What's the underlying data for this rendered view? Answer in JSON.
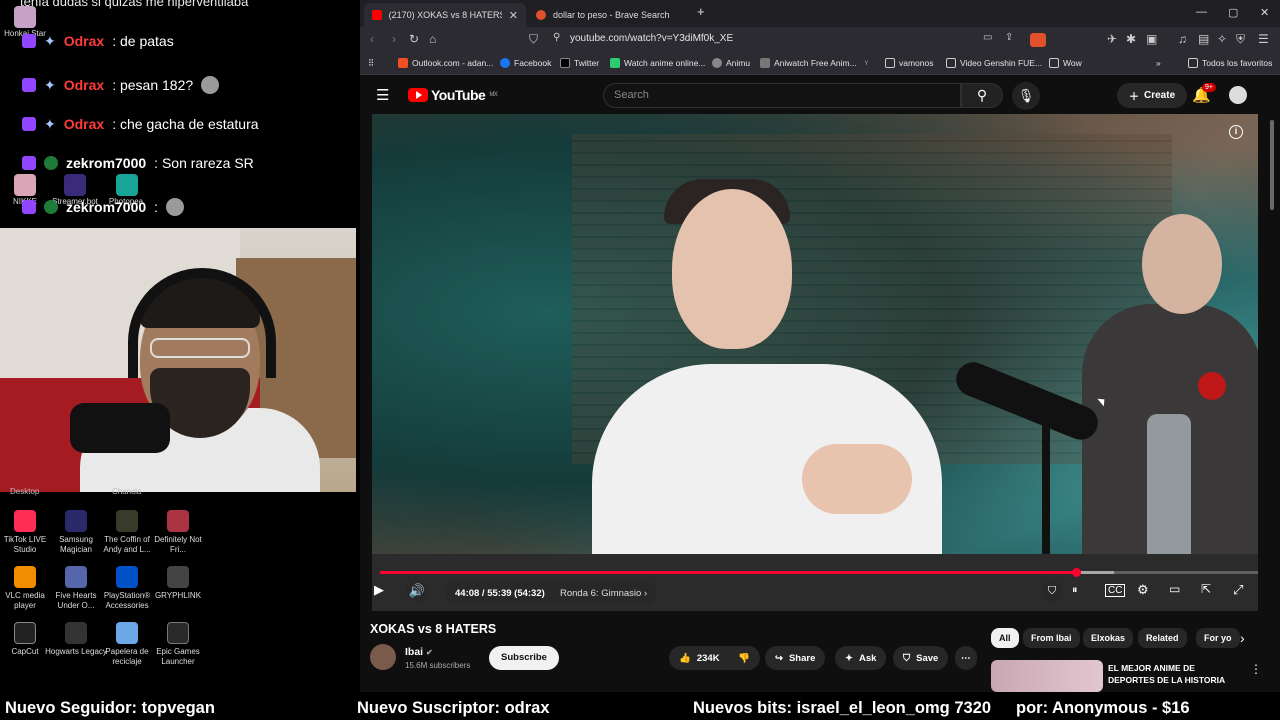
{
  "chat": {
    "top_text": "tenía dudas si quizás me hiperventilaba",
    "messages": [
      {
        "user": "Odrax",
        "text": ": de patas"
      },
      {
        "user": "Odrax",
        "text": ": pesan 182?"
      },
      {
        "user": "Odrax",
        "text": ": che gacha de estatura"
      },
      {
        "user": "zekrom7000",
        "text": ": Son rareza SR"
      },
      {
        "user": "zekrom7000",
        "text": ":"
      }
    ],
    "overlay_labels": [
      "Honkai Star",
      "NIKKE",
      "Streamer.bot",
      "Photopea",
      "Desktop",
      "Chancla"
    ]
  },
  "desktop_icons": [
    {
      "label": "TikTok LIVE Studio",
      "color": "#ff2d55"
    },
    {
      "label": "Samsung Magician",
      "color": "#2a2a6a"
    },
    {
      "label": "The Coffin of Andy and L...",
      "color": "#3a3a2a"
    },
    {
      "label": "Definitely Not Fri...",
      "color": "#aa3344"
    },
    {
      "label": "VLC media player",
      "color": "#f28c00"
    },
    {
      "label": "Five Hearts Under O...",
      "color": "#5566aa"
    },
    {
      "label": "PlayStation® Accessories",
      "color": "#0050c8"
    },
    {
      "label": "GRYPHLINK",
      "color": "#444444"
    },
    {
      "label": "CapCut",
      "color": "#222222"
    },
    {
      "label": "Hogwarts Legacy",
      "color": "#333333"
    },
    {
      "label": "Papelera de reciclaje",
      "color": "#6aa8e8"
    },
    {
      "label": "Epic Games Launcher",
      "color": "#2a2a2a"
    }
  ],
  "browser": {
    "tabs": [
      {
        "title": "(2170) XOKAS vs 8 HATERS - You",
        "active": true
      },
      {
        "title": "dollar to peso - Brave Search",
        "active": false
      }
    ],
    "new_tab": "+",
    "url": "youtube.com/watch?v=Y3diMf0k_XE",
    "bookmarks": [
      "Outlook.com - adan...",
      "Facebook",
      "Twitter",
      "Watch anime online...",
      "Animu",
      "Aniwatch Free Anim...",
      "vamonos",
      "Video Genshin FUE...",
      "Wow",
      "Todos los favoritos"
    ]
  },
  "youtube": {
    "logo": "YouTube",
    "region": "MX",
    "search_placeholder": "Search",
    "create": "Create",
    "notif_count": "9+",
    "player": {
      "time": "44:08 / 55:39 (54:32)",
      "chapter": "Ronda 6: Gimnasio",
      "progress": 0.793,
      "buffer_end": 0.836
    },
    "video_title": "XOKAS vs 8 HATERS",
    "channel": "Ibai",
    "subscribers": "15.6M subscribers",
    "subscribe": "Subscribe",
    "likes": "234K",
    "share": "Share",
    "ask": "Ask",
    "save": "Save",
    "chips": [
      "All",
      "From Ibai",
      "Elxokas",
      "Related",
      "For yo"
    ],
    "rec_title": "EL MEJOR ANIME DE DEPORTES DE LA HISTORIA"
  },
  "ticker": {
    "follower": "Nuevo Seguidor: topvegan",
    "subscriber": "Nuevo Suscriptor: odrax",
    "bits": "Nuevos bits: israel_el_leon_omg 7320",
    "donor": "por: Anonymous - $16"
  }
}
